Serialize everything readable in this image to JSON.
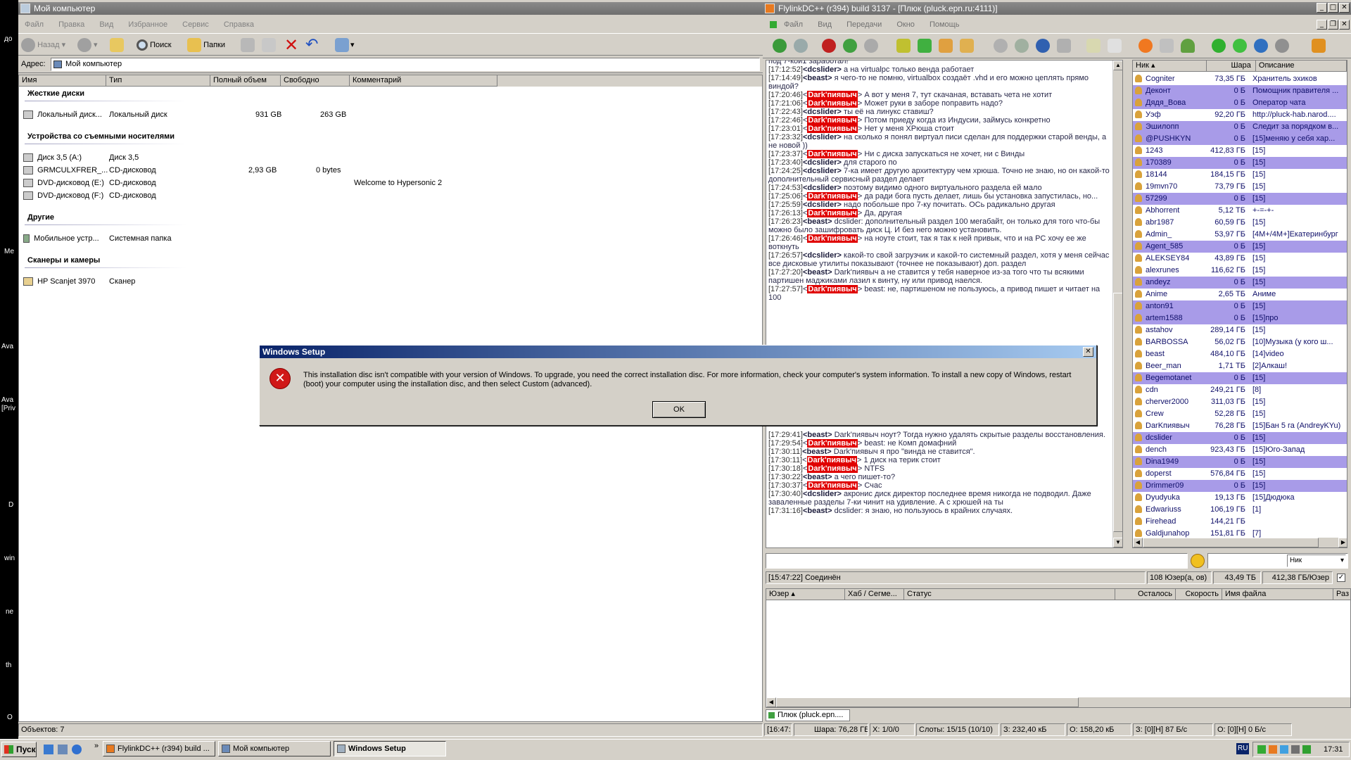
{
  "explorer": {
    "title": "Мой компьютер",
    "menu": [
      "Файл",
      "Правка",
      "Вид",
      "Избранное",
      "Сервис",
      "Справка"
    ],
    "back_label": "Назад",
    "search_label": "Поиск",
    "folders_label": "Папки",
    "address_label": "Адрес:",
    "address_value": "Мой компьютер",
    "columns": [
      "Имя",
      "Тип",
      "Полный объем",
      "Свободно",
      "Комментарий"
    ],
    "groups": {
      "hdd": "Жесткие диски",
      "removable": "Устройства со съемными носителями",
      "other": "Другие",
      "scanners": "Сканеры и камеры"
    },
    "rows": {
      "local": {
        "name": "Локальный диск...",
        "type": "Локальный диск",
        "total": "931 GB",
        "free": "263 GB",
        "comment": ""
      },
      "floppy": {
        "name": "Диск 3,5 (A:)",
        "type": "Диск 3,5",
        "total": "",
        "free": "",
        "comment": ""
      },
      "grm": {
        "name": "GRMCULXFRER_...",
        "type": "CD-дисковод",
        "total": "2,93 GB",
        "free": "0 bytes",
        "comment": ""
      },
      "dvde": {
        "name": "DVD-дисковод (E:)",
        "type": "CD-дисковод",
        "total": "",
        "free": "",
        "comment": "Welcome to Hypersonic 2"
      },
      "dvdf": {
        "name": "DVD-дисковод (F:)",
        "type": "CD-дисковод",
        "total": "",
        "free": "",
        "comment": ""
      },
      "mobile": {
        "name": "Мобильное устр...",
        "type": "Системная папка",
        "total": "",
        "free": "",
        "comment": ""
      },
      "scanner": {
        "name": "HP Scanjet 3970",
        "type": "Сканер",
        "total": "",
        "free": "",
        "comment": ""
      }
    },
    "status": "Объектов: 7"
  },
  "flylink": {
    "title": "FlylinkDC++ (r394) build 3137 - [Плюк (pluck.epn.ru:4111)]",
    "menu": [
      "Файл",
      "Вид",
      "Передачи",
      "Окно",
      "Помощь"
    ],
    "chat": [
      {
        "ts": "",
        "nick": "",
        "dark": false,
        "text": "под 7-кой1 заработал!"
      },
      {
        "ts": "[17:12:52]",
        "nick": "<dcslider>",
        "dark": false,
        "text": " а на virtualpc только венда работает"
      },
      {
        "ts": "[17:14:49]",
        "nick": "<beast>",
        "dark": false,
        "text": " я чего-то не помню, virtualbox создаёт .vhd и его можно цеплять прямо виндой?"
      },
      {
        "ts": "[17:20:46]",
        "nick": "Dark'пиявыч",
        "dark": true,
        "text": " А вот у меня 7, тут скачаная, вставать чета не хотит"
      },
      {
        "ts": "[17:21:06]",
        "nick": "Dark'пиявыч",
        "dark": true,
        "text": " Может руки в заборе поправить надо?"
      },
      {
        "ts": "[17:22:43]",
        "nick": "<dcslider>",
        "dark": false,
        "text": " ты её на линукс ставиш?"
      },
      {
        "ts": "[17:22:46]",
        "nick": "Dark'пиявыч",
        "dark": true,
        "text": " Потом приеду когда из Индусии, займусь конкретно"
      },
      {
        "ts": "[17:23:01]",
        "nick": "Dark'пиявыч",
        "dark": true,
        "text": " Нет у меня ХРюша стоит"
      },
      {
        "ts": "[17:23:32]",
        "nick": "<dcslider>",
        "dark": false,
        "text": " на сколько я понял виртуал писи сделан для поддержки старой венды, а не новой ))"
      },
      {
        "ts": "[17:23:37]",
        "nick": "Dark'пиявыч",
        "dark": true,
        "text": " Ни с диска запускаться не хочет, ни с Винды"
      },
      {
        "ts": "[17:23:40]",
        "nick": "<dcslider>",
        "dark": false,
        "text": " для старого по"
      },
      {
        "ts": "[17:24:25]",
        "nick": "<dcslider>",
        "dark": false,
        "text": " 7-ка имеет другую архитектуру чем хрюша. Точно не знаю, но он какой-то дополнительный сервисный раздел делает"
      },
      {
        "ts": "[17:24:53]",
        "nick": "<dcslider>",
        "dark": false,
        "text": " поэтому видимо одного виртуального раздела ей мало"
      },
      {
        "ts": "[17:25:06]",
        "nick": "Dark'пиявыч",
        "dark": true,
        "text": " да ради бога пусть делает, лишь бы установка запустилась, но..."
      },
      {
        "ts": "[17:25:59]",
        "nick": "<dcslider>",
        "dark": false,
        "text": " надо побольше про 7-ку почитать. ОСь радикально другая"
      },
      {
        "ts": "[17:26:13]",
        "nick": "Dark'пиявыч",
        "dark": true,
        "text": " Да, другая"
      },
      {
        "ts": "[17:26:23]",
        "nick": "<beast>",
        "dark": false,
        "text": " dcslider: дополнительный раздел 100 мегабайт, он только для того что-бы можно было зашифровать диск Ц. И без него можно установить."
      },
      {
        "ts": "[17:26:46]",
        "nick": "Dark'пиявыч",
        "dark": true,
        "text": " на ноуте стоит, так я так к ней привык, что и на PC хочу ее же воткнуть"
      },
      {
        "ts": "[17:26:57]",
        "nick": "<dcslider>",
        "dark": false,
        "text": " какой-то свой загрузчик и какой-то системный раздел, хотя у меня сейчас все дисковые утилиты показывают (точнее не показывают) доп. раздел"
      },
      {
        "ts": "[17:27:20]",
        "nick": "<beast>",
        "dark": false,
        "text": " Dark'пиявыч а не ставится у тебя наверное из-за того что ты всякими партишен маджиками лазил к винту, ну или привод наелся."
      },
      {
        "ts": "[17:27:57]",
        "nick": "Dark'пиявыч",
        "dark": true,
        "text": " beast: не, партишеном не пользуюсь, а привод пишет и читает на 100"
      }
    ],
    "chat_bottom": [
      {
        "ts": "[17:29:41]",
        "nick": "<beast>",
        "dark": false,
        "text": " Dark'пиявыч ноут? Тогда нужно удалять скрытые разделы восстановления."
      },
      {
        "ts": "[17:29:54]",
        "nick": "Dark'пиявыч",
        "dark": true,
        "text": " beast: не Комп домафний"
      },
      {
        "ts": "[17:30:11]",
        "nick": "<beast>",
        "dark": false,
        "text": " Dark'пиявыч я про \"винда не ставится\"."
      },
      {
        "ts": "[17:30:11]",
        "nick": "Dark'пиявыч",
        "dark": true,
        "text": " 1 диск на терик стоит"
      },
      {
        "ts": "[17:30:18]",
        "nick": "Dark'пиявыч",
        "dark": true,
        "text": " NTFS"
      },
      {
        "ts": "[17:30:22]",
        "nick": "<beast>",
        "dark": false,
        "text": " а чего пишет-то?"
      },
      {
        "ts": "[17:30:37]",
        "nick": "Dark'пиявыч",
        "dark": true,
        "text": " Счас"
      },
      {
        "ts": "[17:30:40]",
        "nick": "<dcslider>",
        "dark": false,
        "text": " акронис диск директор последнее время никогда не подводил. Даже заваленные разделы 7-ки чинит на удивление. А с хрюшей на ты"
      },
      {
        "ts": "[17:31:16]",
        "nick": "<beast>",
        "dark": false,
        "text": " dcslider: я знаю, но пользуюсь в крайних случаях."
      }
    ],
    "user_columns": [
      "Ник",
      "Шара",
      "Описание"
    ],
    "users": [
      {
        "nick": "Cogniter",
        "share": "73,35 ГБ",
        "desc": "Хранитель эхиков",
        "hl": false
      },
      {
        "nick": "Деконт",
        "share": "0 Б",
        "desc": "Помощник правителя ...",
        "hl": true
      },
      {
        "nick": "Дядя_Вова",
        "share": "0 Б",
        "desc": "Оператор чата",
        "hl": true
      },
      {
        "nick": "Уэф",
        "share": "92,20 ГБ",
        "desc": "http://pluck-hab.narod....",
        "hl": false
      },
      {
        "nick": "Эшилопп",
        "share": "0 Б",
        "desc": "Следит за порядком в...",
        "hl": true
      },
      {
        "nick": "@PUSHKYN",
        "share": "0 Б",
        "desc": "[15]меняю у себя хар...",
        "hl": true
      },
      {
        "nick": "1243",
        "share": "412,83 ГБ",
        "desc": "[15]",
        "hl": false
      },
      {
        "nick": "170389",
        "share": "0 Б",
        "desc": "[15]",
        "hl": true
      },
      {
        "nick": "18144",
        "share": "184,15 ГБ",
        "desc": "[15]",
        "hl": false
      },
      {
        "nick": "19mvn70",
        "share": "73,79 ГБ",
        "desc": "[15]",
        "hl": false
      },
      {
        "nick": "57299",
        "share": "0 Б",
        "desc": "[15]",
        "hl": true
      },
      {
        "nick": "Abhorrent",
        "share": "5,12 ТБ",
        "desc": "+-=-+-",
        "hl": false
      },
      {
        "nick": "abr1987",
        "share": "60,59 ГБ",
        "desc": "[15]",
        "hl": false
      },
      {
        "nick": "Admin_",
        "share": "53,97 ГБ",
        "desc": "[4M+/4M+]Екатеринбург",
        "hl": false
      },
      {
        "nick": "Agent_585",
        "share": "0 Б",
        "desc": "[15]",
        "hl": true
      },
      {
        "nick": "ALEKSEY84",
        "share": "43,89 ГБ",
        "desc": "[15]",
        "hl": false
      },
      {
        "nick": "alexrunes",
        "share": "116,62 ГБ",
        "desc": "[15]",
        "hl": false
      },
      {
        "nick": "andeyz",
        "share": "0 Б",
        "desc": "[15]",
        "hl": true
      },
      {
        "nick": "Anime",
        "share": "2,65 ТБ",
        "desc": "Аниме",
        "hl": false
      },
      {
        "nick": "anton91",
        "share": "0 Б",
        "desc": "[15]",
        "hl": true
      },
      {
        "nick": "artem1588",
        "share": "0 Б",
        "desc": "[15]про",
        "hl": true
      },
      {
        "nick": "astahov",
        "share": "289,14 ГБ",
        "desc": "[15]",
        "hl": false
      },
      {
        "nick": "BARBOSSA",
        "share": "56,02 ГБ",
        "desc": "[10]Музыка (у кого ш...",
        "hl": false
      },
      {
        "nick": "beast",
        "share": "484,10 ГБ",
        "desc": "[14]video",
        "hl": false
      },
      {
        "nick": "Beer_man",
        "share": "1,71 ТБ",
        "desc": "[2]Алкаш!",
        "hl": false
      },
      {
        "nick": "Begemotanet",
        "share": "0 Б",
        "desc": "[15]",
        "hl": true
      },
      {
        "nick": "cdn",
        "share": "249,21 ГБ",
        "desc": "[8]",
        "hl": false
      },
      {
        "nick": "cherver2000",
        "share": "311,03 ГБ",
        "desc": "[15]",
        "hl": false
      },
      {
        "nick": "Crew",
        "share": "52,28 ГБ",
        "desc": "[15]",
        "hl": false
      },
      {
        "nick": "DarKпиявыч",
        "share": "76,28 ГБ",
        "desc": "[15]Бан 5 га (AndreyKYu)",
        "hl": false
      },
      {
        "nick": "dcslider",
        "share": "0 Б",
        "desc": "[15]",
        "hl": true
      },
      {
        "nick": "dench",
        "share": "923,43 ГБ",
        "desc": "[15]Юго-Запад",
        "hl": false
      },
      {
        "nick": "Dina1949",
        "share": "0 Б",
        "desc": "[15]",
        "hl": true
      },
      {
        "nick": "doperst",
        "share": "576,84 ГБ",
        "desc": "[15]",
        "hl": false
      },
      {
        "nick": "Drimmer09",
        "share": "0 Б",
        "desc": "[15]",
        "hl": true
      },
      {
        "nick": "Dyudyuka",
        "share": "19,13 ГБ",
        "desc": "[15]Дюдюка",
        "hl": false
      },
      {
        "nick": "Edwariuss",
        "share": "106,19 ГБ",
        "desc": "[1]",
        "hl": false
      },
      {
        "nick": "Firehead",
        "share": "144,21 ГБ",
        "desc": "",
        "hl": false
      },
      {
        "nick": "Galdjunahop",
        "share": "151,81 ГБ",
        "desc": "[7]",
        "hl": false
      }
    ],
    "nick_select": "Ник",
    "status": {
      "connected": "[15:47:22] Соединён",
      "users": "108 Юзер(а, ов)",
      "share": "43,49 ТБ",
      "per_user": "412,38 ГБ/Юзер"
    },
    "transfer_columns": [
      "Юзер",
      "Хаб / Сегме...",
      "Статус",
      "Осталось",
      "Скорость",
      "Имя файла",
      "Раз"
    ],
    "hub_tab": "Плюк (pluck.epn....",
    "bottom_status": {
      "time": "[16:47:",
      "share": "Шара: 76,28 ГБ",
      "x": "Х: 1/0/0",
      "slots": "Слоты: 15/15 (10/10)",
      "d": "З: 232,40 кБ",
      "o": "О: 158,20 кБ",
      "d2": "З: [0][Н] 87 Б/с",
      "o2": "О: [0][Н] 0 Б/с"
    }
  },
  "dialog": {
    "title": "Windows Setup",
    "message": "This installation disc isn't compatible with your version of Windows. To upgrade, you need the correct installation disc. For more information, check your computer's system information. To install a new copy of Windows, restart (boot) your computer using the installation disc, and then select Custom (advanced).",
    "ok_label": "OK"
  },
  "taskbar": {
    "start_label": "Пуск",
    "tasks": [
      "FlylinkDC++ (r394) build ...",
      "Мой компьютер",
      "Windows Setup"
    ],
    "lang": "RU",
    "clock": "17:31"
  },
  "desktop_labels": [
    "до",
    "Ме",
    "Ava",
    "Ava [Priv",
    "D",
    "win",
    "ne",
    "th",
    "O"
  ]
}
